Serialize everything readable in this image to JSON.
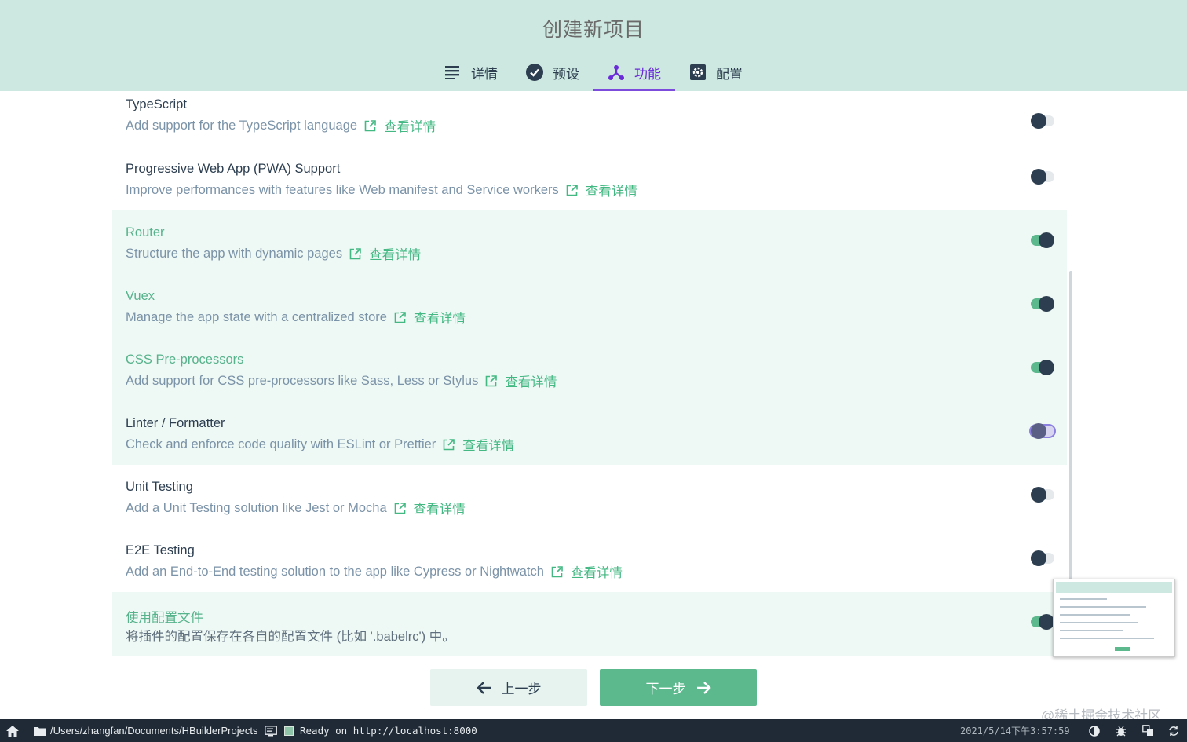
{
  "header": {
    "title": "创建新项目",
    "tabs": [
      {
        "label": "详情",
        "icon": "list-icon"
      },
      {
        "label": "预设",
        "icon": "check-circle-icon"
      },
      {
        "label": "功能",
        "icon": "fork-icon",
        "active": true
      },
      {
        "label": "配置",
        "icon": "gear-icon"
      }
    ]
  },
  "features": {
    "more_label": "查看详情",
    "items": [
      {
        "name": "TypeScript",
        "desc": "Add support for the TypeScript language",
        "enabled": false
      },
      {
        "name": "Progressive Web App (PWA) Support",
        "desc": "Improve performances with features like Web manifest and Service workers",
        "enabled": false
      },
      {
        "name": "Router",
        "desc": "Structure the app with dynamic pages",
        "enabled": true
      },
      {
        "name": "Vuex",
        "desc": "Manage the app state with a centralized store",
        "enabled": true
      },
      {
        "name": "CSS Pre-processors",
        "desc": "Add support for CSS pre-processors like Sass, Less or Stylus",
        "enabled": true
      },
      {
        "name": "Linter / Formatter",
        "desc": "Check and enforce code quality with ESLint or Prettier",
        "enabled": false
      },
      {
        "name": "Unit Testing",
        "desc": "Add a Unit Testing solution like Jest or Mocha",
        "enabled": false
      },
      {
        "name": "E2E Testing",
        "desc": "Add an End-to-End testing solution to the app like Cypress or Nightwatch",
        "enabled": false
      }
    ],
    "config_file": {
      "name": "使用配置文件",
      "desc": "将插件的配置保存在各自的配置文件 (比如 '.babelrc') 中。",
      "enabled": true
    }
  },
  "buttons": {
    "prev": "上一步",
    "next": "下一步"
  },
  "watermark": "@稀土掘金技术社区",
  "statusbar": {
    "path": "/Users/zhangfan/Documents/HBuilderProjects",
    "status": "Ready on http://localhost:8000",
    "time": "2021/5/14下午3:57:59"
  },
  "colors": {
    "accent": "#5cb98e",
    "tab_active": "#6a2bd8",
    "header_bg": "#cde8e0"
  }
}
